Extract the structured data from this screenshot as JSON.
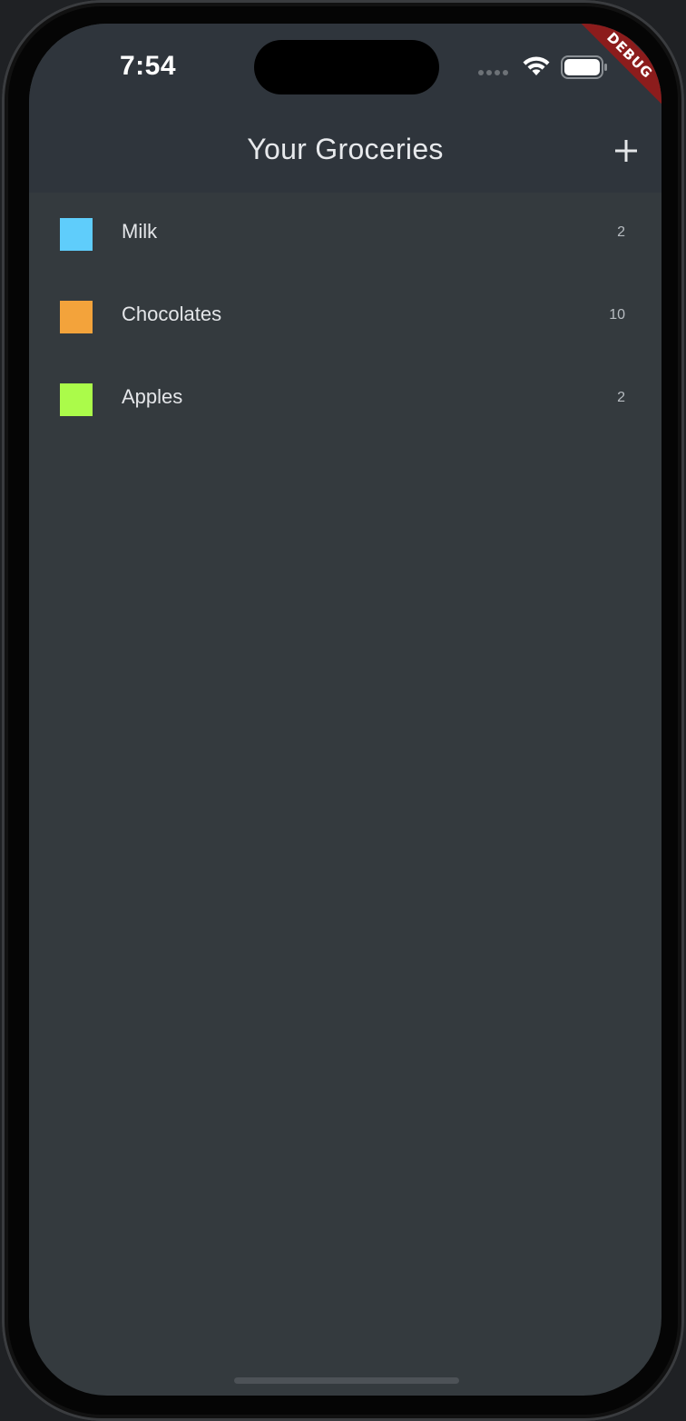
{
  "status_bar": {
    "time": "7:54"
  },
  "debug_banner": "DEBUG",
  "app_bar": {
    "title": "Your Groceries",
    "add_icon": "plus-icon"
  },
  "groceries": [
    {
      "name": "Milk",
      "quantity": "2",
      "color": "#5fcdfb"
    },
    {
      "name": "Chocolates",
      "quantity": "10",
      "color": "#f3a33b"
    },
    {
      "name": "Apples",
      "quantity": "2",
      "color": "#abfb4a"
    }
  ],
  "colors": {
    "app_bar_bg": "#2f353c",
    "body_bg": "#343a3e",
    "debug_banner": "#8c1c1c"
  }
}
